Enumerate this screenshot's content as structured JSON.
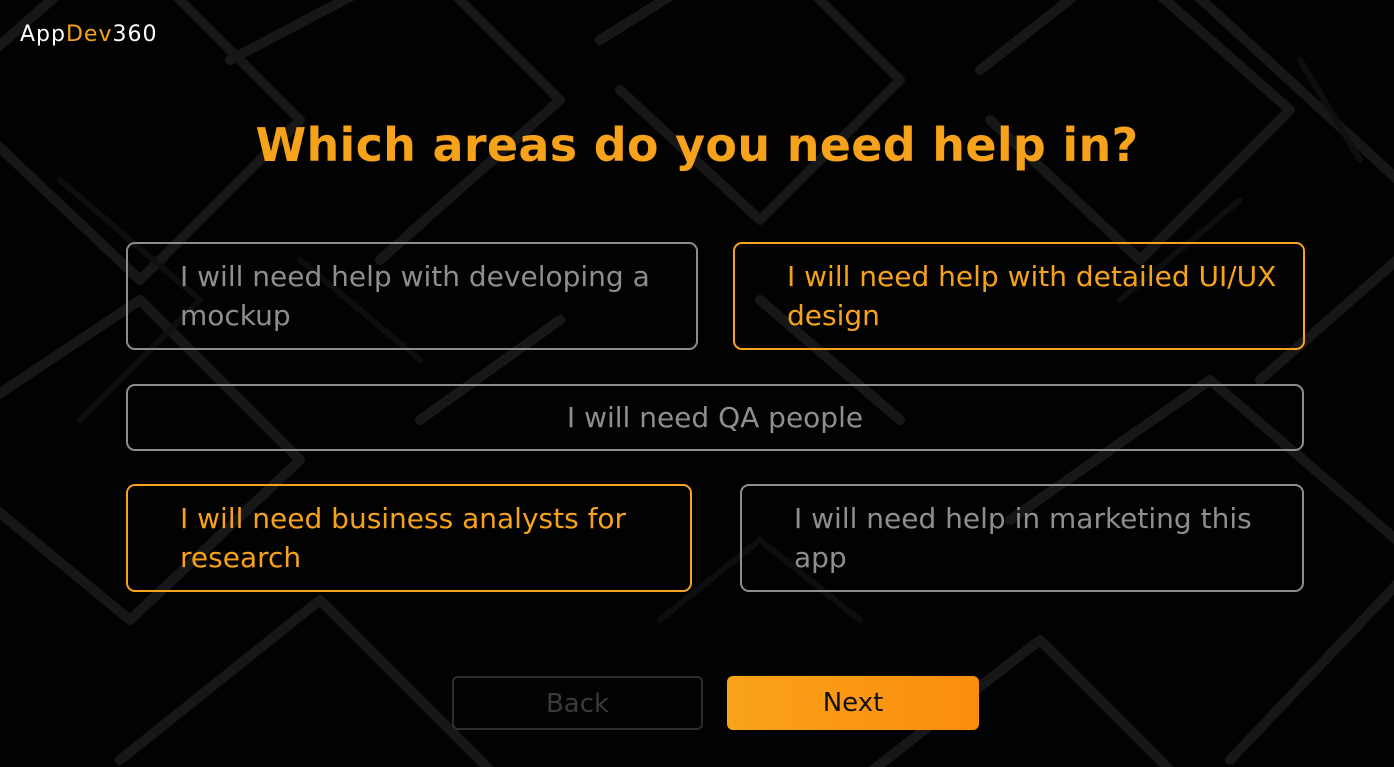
{
  "brand": {
    "part1": "App",
    "part2": "Dev",
    "part3": "360",
    "accent_color": "#f7a21b"
  },
  "question": {
    "title": "Which areas do you need help in?"
  },
  "options": [
    {
      "label": "I will need help with developing a mockup",
      "selected": false
    },
    {
      "label": "I will need help with detailed UI/UX design",
      "selected": true
    },
    {
      "label": "I will need QA people",
      "selected": false
    },
    {
      "label": "I will need business analysts for research",
      "selected": true
    },
    {
      "label": "I will need help in marketing this app",
      "selected": false
    }
  ],
  "navigation": {
    "back_label": "Back",
    "next_label": "Next"
  },
  "colors": {
    "background": "#020202",
    "unselected": "#8d8d8d",
    "selected": "#f7a21b",
    "next_button": "#fb9a14"
  }
}
